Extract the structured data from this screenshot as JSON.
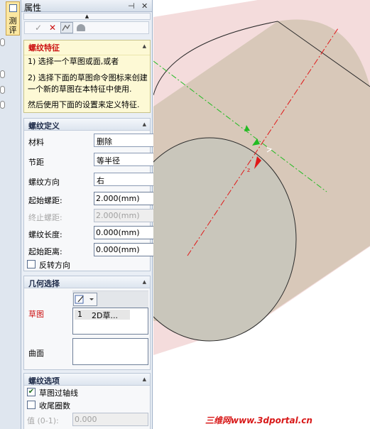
{
  "strip": {
    "tab_label": "测\n评"
  },
  "panel": {
    "title": "属性",
    "pin_glyph": "⊣",
    "close_glyph": "✕"
  },
  "toolbar": {
    "ok": "✓",
    "cancel": "✕"
  },
  "info": {
    "title": "螺纹特征",
    "line1": "1) 选择一个草图或面,或者",
    "line2": "2) 选择下面的草图命令图标来创建一个新的草图在本特征中使用.",
    "line3": "然后使用下面的设置来定义特征."
  },
  "thread_def": {
    "title": "螺纹定义",
    "material_label": "材料",
    "material_value": "删除",
    "pitch_label": "节距",
    "pitch_value": "等半径",
    "direction_label": "螺纹方向",
    "direction_value": "右",
    "start_pitch_label": "起始螺距:",
    "start_pitch_value": "2.000(mm)",
    "end_pitch_label": "终止螺距:",
    "end_pitch_value": "2.000(mm)",
    "length_label": "螺纹长度:",
    "length_value": "0.000(mm)",
    "start_dist_label": "起始距离:",
    "start_dist_value": "0.000(mm)",
    "reverse_label": "反转方向",
    "reverse_checked": false
  },
  "geometry": {
    "title": "几何选择",
    "sketch_label": "草图",
    "sketch_item_index": "1",
    "sketch_item_text": "2D草...",
    "surface_label": "曲面"
  },
  "options": {
    "title": "螺纹选项",
    "through_axis_label": "草图过轴线",
    "through_axis_checked": true,
    "tail_label": "收尾圈数",
    "tail_checked": false,
    "value_label": "值 (0-1):",
    "value_value": "0.000"
  },
  "watermark": "三维网www.3dportal.cn",
  "colors": {
    "cylinder_body": "#d8c8b9",
    "cylinder_cap": "#c9c6bb",
    "plane_tint": "#f4dcdc",
    "axis_red": "#e01818",
    "axis_green": "#22bb22"
  }
}
